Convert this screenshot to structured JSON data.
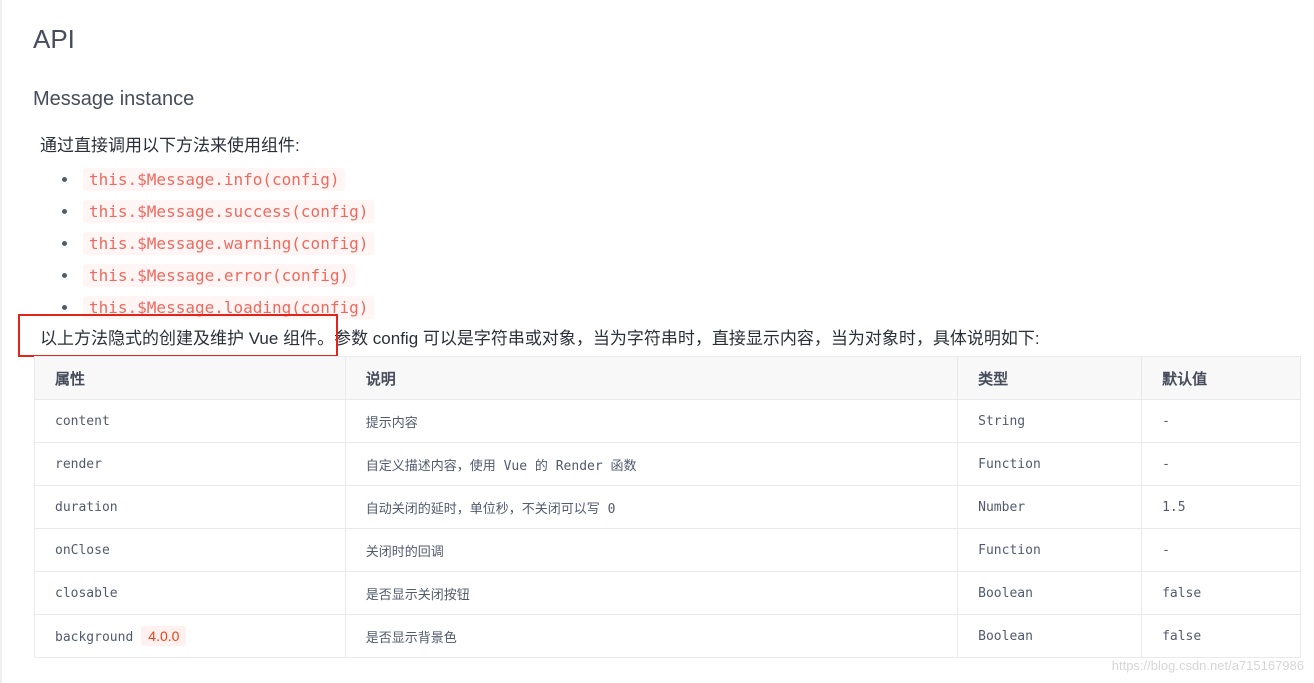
{
  "heading": "API",
  "subheading": "Message instance",
  "intro": "通过直接调用以下方法来使用组件:",
  "methods": [
    "this.$Message.info(config)",
    "this.$Message.success(config)",
    "this.$Message.warning(config)",
    "this.$Message.error(config)",
    "this.$Message.loading(config)"
  ],
  "description": "以上方法隐式的创建及维护 Vue 组件。参数 config 可以是字符串或对象，当为字符串时，直接显示内容，当为对象时，具体说明如下:",
  "table": {
    "headers": [
      "属性",
      "说明",
      "类型",
      "默认值"
    ],
    "rows": [
      {
        "prop": "content",
        "desc": "提示内容",
        "type": "String",
        "default": "-"
      },
      {
        "prop": "render",
        "desc": "自定义描述内容，使用 Vue 的 Render 函数",
        "type": "Function",
        "default": "-"
      },
      {
        "prop": "duration",
        "desc": "自动关闭的延时，单位秒，不关闭可以写 0",
        "type": "Number",
        "default": "1.5"
      },
      {
        "prop": "onClose",
        "desc": "关闭时的回调",
        "type": "Function",
        "default": "-"
      },
      {
        "prop": "closable",
        "desc": "是否显示关闭按钮",
        "type": "Boolean",
        "default": "false"
      },
      {
        "prop": "background",
        "badge": "4.0.0",
        "desc": "是否显示背景色",
        "type": "Boolean",
        "default": "false"
      }
    ]
  },
  "watermark": "https://blog.csdn.net/a715167986",
  "colors": {
    "code": "#ed6a5f",
    "highlight_box": "#e1251b",
    "text": "#515a6e"
  }
}
